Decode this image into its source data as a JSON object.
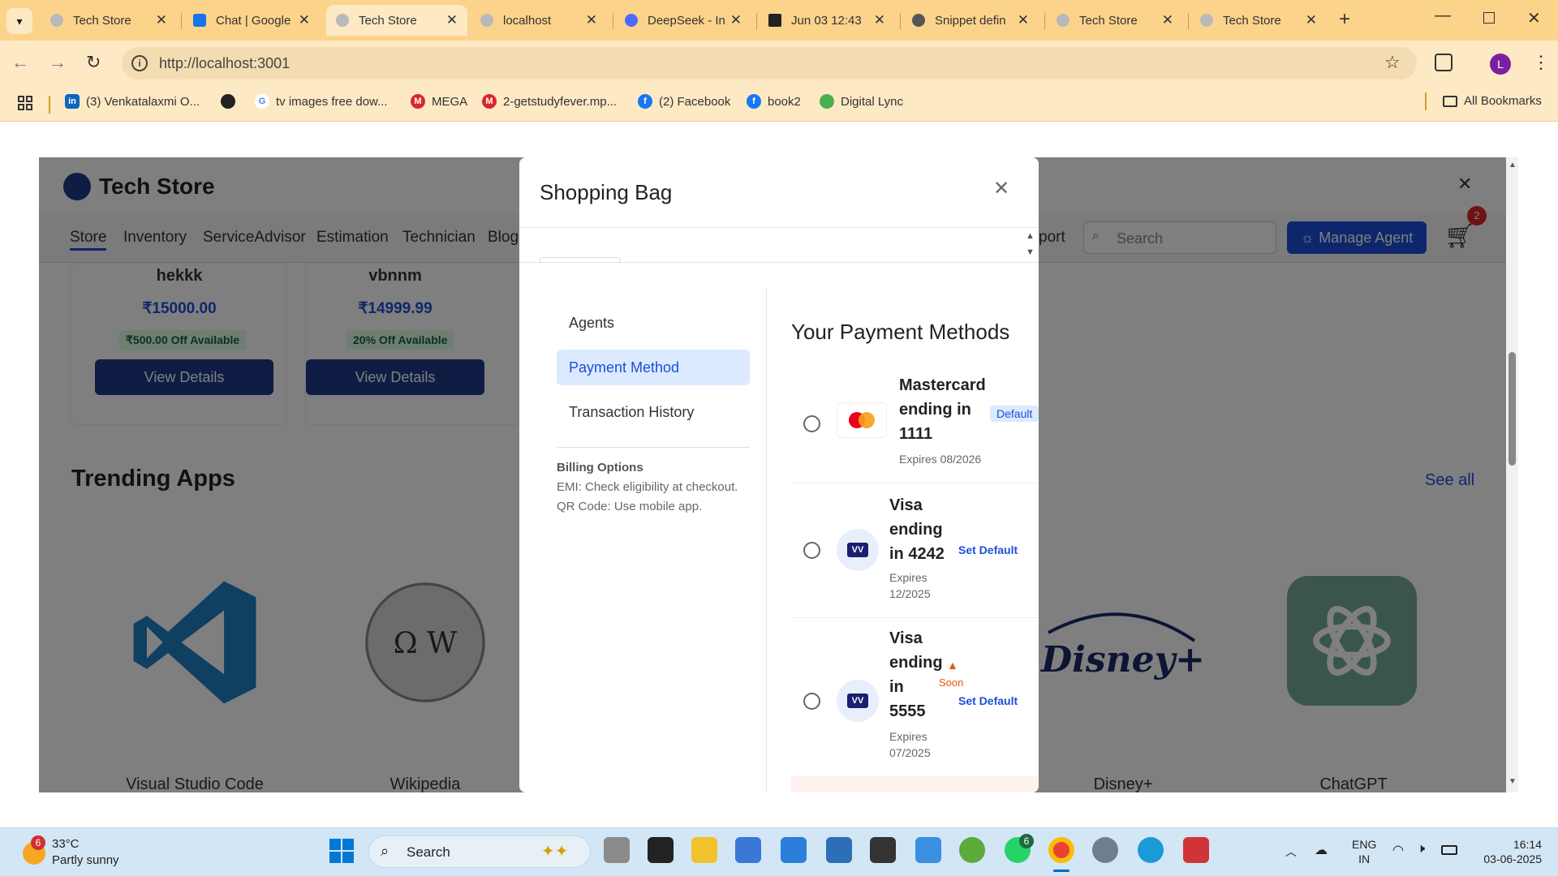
{
  "browser": {
    "tabs": [
      {
        "title": "Tech Store",
        "active": false
      },
      {
        "title": "Chat | Google",
        "active": false
      },
      {
        "title": "Tech Store",
        "active": true
      },
      {
        "title": "localhost",
        "active": false
      },
      {
        "title": "DeepSeek - Into",
        "active": false
      },
      {
        "title": "Jun 03 12:43",
        "active": false
      },
      {
        "title": "Snippet defin",
        "active": false
      },
      {
        "title": "Tech Store",
        "active": false
      },
      {
        "title": "Tech Store",
        "active": false
      }
    ],
    "url": "http://localhost:3001",
    "profile_initial": "L",
    "bookmarks": [
      {
        "label": "(3) Venkatalaxmi O...",
        "icon": "linkedin-icon",
        "color": "#0a66c2"
      },
      {
        "label": "",
        "icon": "globe-icon",
        "color": "#222222"
      },
      {
        "label": "tv images free dow...",
        "icon": "google-icon",
        "color": "#4285f4"
      },
      {
        "label": "MEGA",
        "icon": "mega-icon",
        "color": "#d9272e"
      },
      {
        "label": "2-getstudyfever.mp...",
        "icon": "mega-icon",
        "color": "#d9272e"
      },
      {
        "label": "(2) Facebook",
        "icon": "facebook-icon",
        "color": "#1877f2"
      },
      {
        "label": "book2",
        "icon": "facebook-icon",
        "color": "#1877f2"
      },
      {
        "label": "Digital Lync",
        "icon": "digital-lync-icon",
        "color": "#4caf50"
      }
    ],
    "all_bookmarks": "All Bookmarks"
  },
  "store": {
    "brand": "Tech Store",
    "nav": [
      "Store",
      "Inventory",
      "ServiceAdvisor",
      "Estimation",
      "Technician",
      "Blog"
    ],
    "nav_partial": "port",
    "search_placeholder": "Search",
    "manage_agent": "Manage Agent",
    "cart_count": "2",
    "products": [
      {
        "name": "hekkk",
        "price": "₹15000.00",
        "offer": "₹500.00 Off Available",
        "button": "View Details"
      },
      {
        "name": "vbnnm",
        "price": "₹14999.99",
        "offer": "20% Off Available",
        "button": "View Details"
      }
    ],
    "trending_title": "Trending Apps",
    "see_all": "See all",
    "apps": [
      {
        "name": "Visual Studio Code"
      },
      {
        "name": "Wikipedia"
      },
      {
        "name": "Disney+"
      },
      {
        "name": "ChatGPT"
      }
    ]
  },
  "modal": {
    "title": "Shopping Bag",
    "sidebar": [
      {
        "label": "Agents",
        "active": false
      },
      {
        "label": "Payment Method",
        "active": true
      },
      {
        "label": "Transaction History",
        "active": false
      }
    ],
    "billing_title": "Billing Options",
    "billing_lines": [
      "EMI: Check eligibility at checkout.",
      "QR Code: Use mobile app."
    ],
    "payment_title": "Your Payment Methods",
    "methods": [
      {
        "title": [
          "Mastercard",
          "ending in",
          "1111"
        ],
        "expires": [
          "Expires 08/2026"
        ],
        "badge": "Default",
        "action": "",
        "logo": "mastercard-icon"
      },
      {
        "title": [
          "Visa",
          "ending",
          "in 4242"
        ],
        "expires": [
          "Expires",
          "12/2025"
        ],
        "badge": "",
        "action": "Set Default",
        "logo": "visa-icon"
      },
      {
        "title": [
          "Visa",
          "ending",
          "in",
          "5555"
        ],
        "expires": [
          "Expires",
          "07/2025"
        ],
        "badge": "Soon",
        "action": "Set Default",
        "logo": "visa-icon"
      }
    ],
    "visa_logo_text": "VV"
  },
  "taskbar": {
    "weather_temp": "33°C",
    "weather_desc": "Partly sunny",
    "weather_badge": "6",
    "search": "Search",
    "whatsapp_badge": "6",
    "lang": "ENG",
    "region": "IN",
    "time": "16:14",
    "date": "03-06-2025"
  },
  "colors": {
    "accent": "#1e3a8a",
    "link": "#1d4ed8",
    "chrome": "#fbd38b"
  }
}
